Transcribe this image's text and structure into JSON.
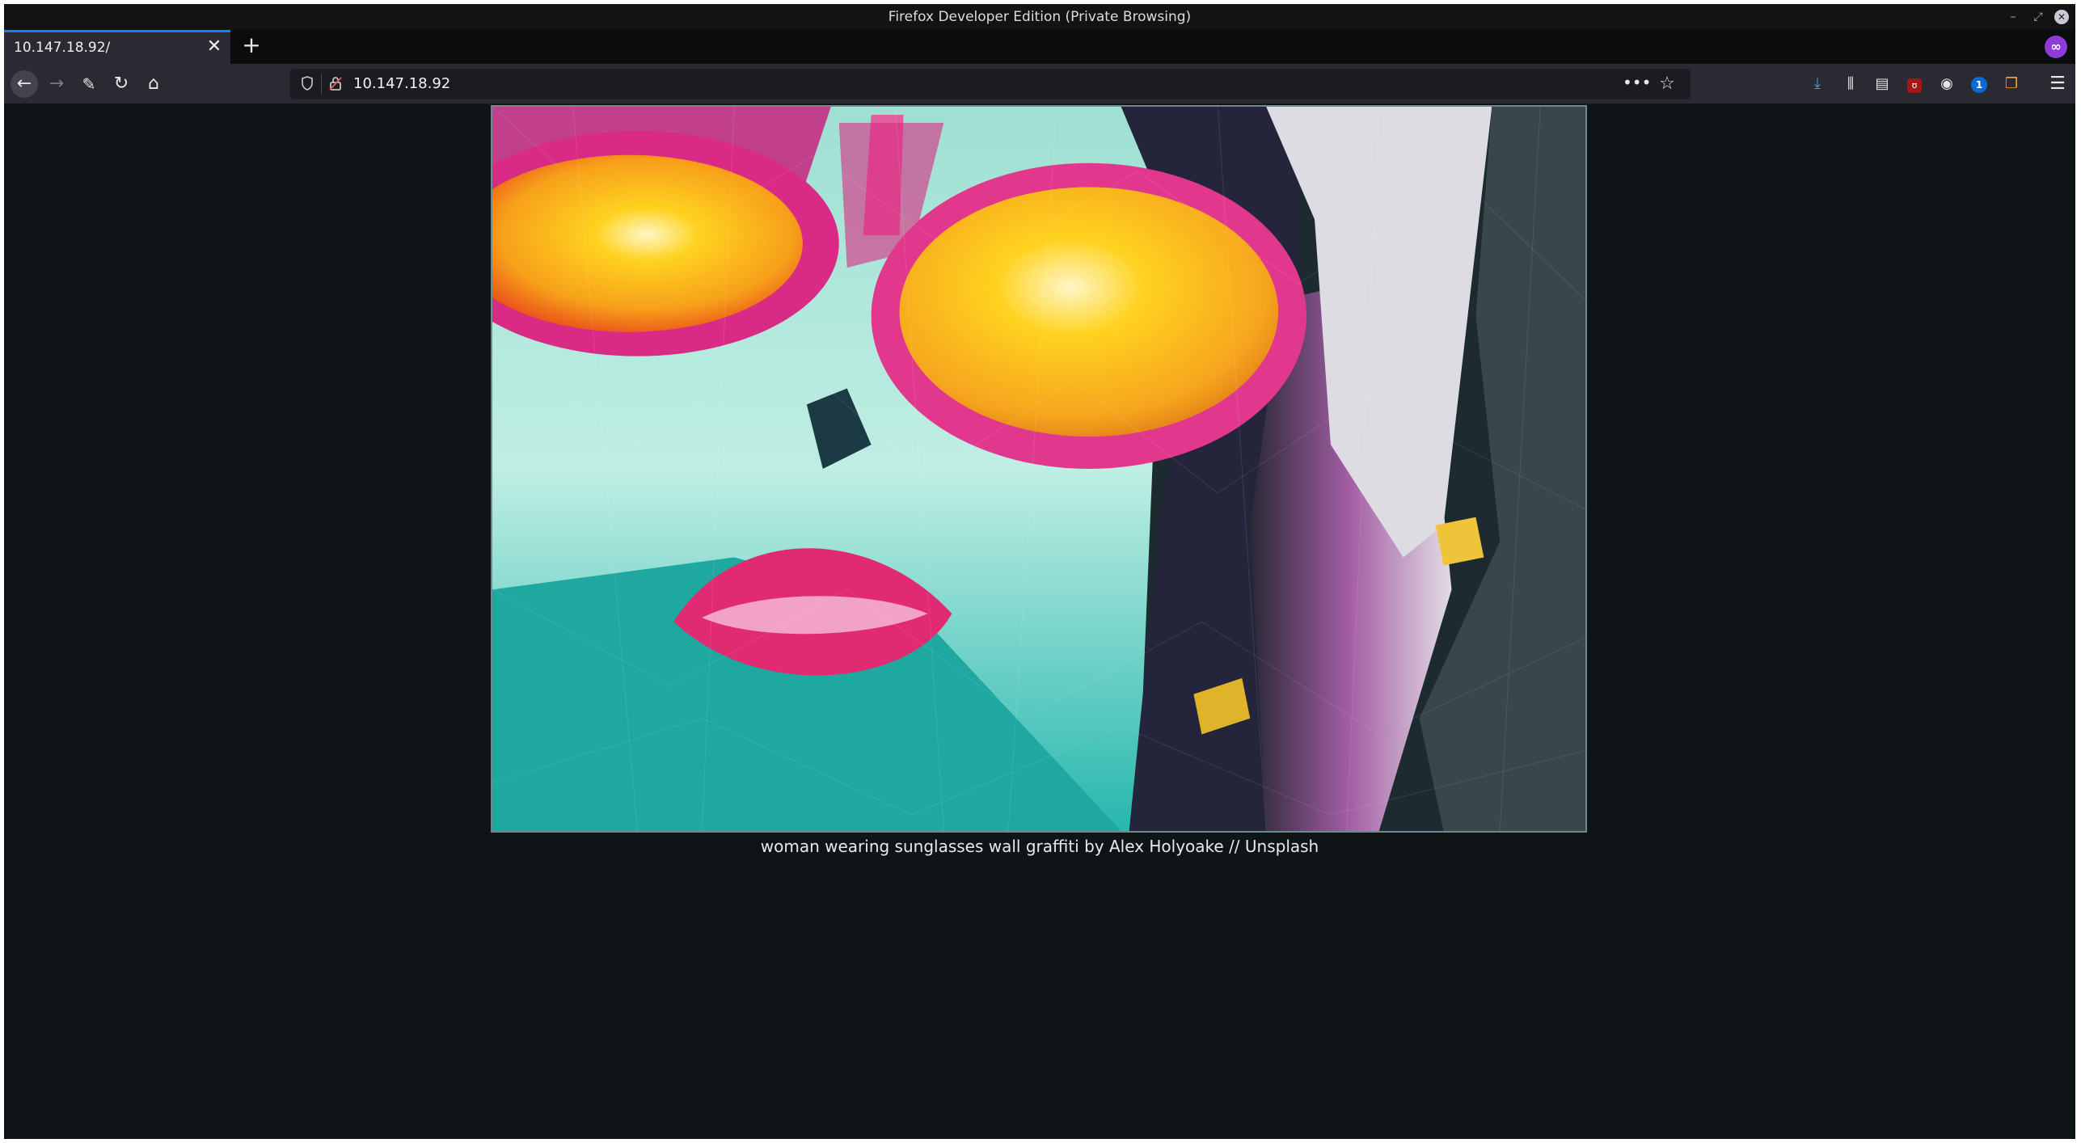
{
  "window": {
    "title": "Firefox Developer Edition (Private Browsing)",
    "controls": {
      "minimize": "–",
      "maximize": "⤢",
      "close": "✕"
    }
  },
  "tabs": [
    {
      "label": "10.147.18.92/",
      "close_glyph": "✕",
      "active": true
    }
  ],
  "tabstrip": {
    "new_tab_glyph": "+",
    "private_glyph": "∞"
  },
  "navbar": {
    "back_glyph": "←",
    "forward_glyph": "→",
    "tools_glyph": "✎",
    "reload_glyph": "↻",
    "home_glyph": "⌂",
    "url": "10.147.18.92",
    "page_actions_glyph": "•••",
    "bookmark_glyph": "☆"
  },
  "toolbar_icons": {
    "download": "⤓",
    "library": "⫼",
    "sidebar": "▤",
    "ublock": "ʊ",
    "account": "◉",
    "onepassword": "1",
    "containers": "❐",
    "menu": "☰"
  },
  "content": {
    "caption": "woman wearing sunglasses wall graffiti by Alex Holyoake // Unsplash",
    "image_subject": "low-poly triangulated graffiti of a woman wearing pink-rimmed yellow sunglasses with pink lips on a teal face"
  },
  "colors": {
    "chrome_dark": "#2b2a33",
    "tab_accent": "#0a84ff",
    "page_bg": "#0f1417",
    "private_purple": "#8f3bd9"
  }
}
